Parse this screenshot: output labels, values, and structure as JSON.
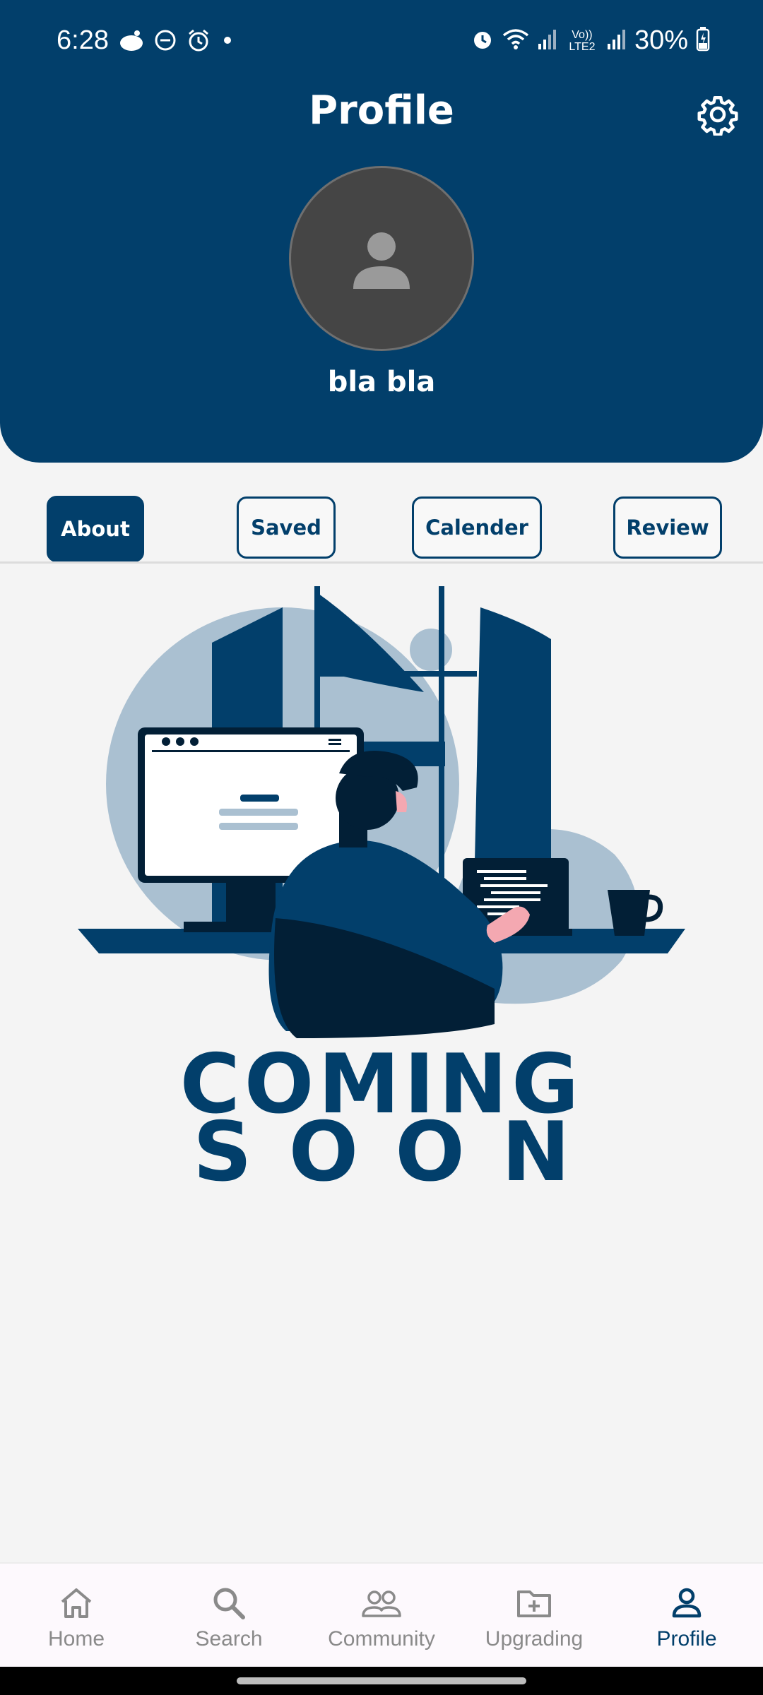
{
  "status_bar": {
    "time": "6:28",
    "battery": "30%",
    "network_label": "Vo)) LTE2"
  },
  "header": {
    "title": "Profile",
    "user_name": "bla bla",
    "settings_icon": "gear-icon",
    "avatar_icon": "person-icon"
  },
  "tabs": [
    {
      "label": "About",
      "active": true
    },
    {
      "label": "Saved",
      "active": false
    },
    {
      "label": "Calender",
      "active": false
    },
    {
      "label": "Review",
      "active": false
    }
  ],
  "content": {
    "line1": "COMING",
    "line2": "SOON"
  },
  "bottom_nav": [
    {
      "label": "Home",
      "icon": "home-icon",
      "active": false
    },
    {
      "label": "Search",
      "icon": "search-icon",
      "active": false
    },
    {
      "label": "Community",
      "icon": "community-icon",
      "active": false
    },
    {
      "label": "Upgrading",
      "icon": "folder-add-icon",
      "active": false
    },
    {
      "label": "Profile",
      "icon": "profile-icon",
      "active": true
    }
  ],
  "colors": {
    "primary": "#023f6b",
    "background": "#f4f4f4",
    "inactive": "#8a8a8a"
  }
}
